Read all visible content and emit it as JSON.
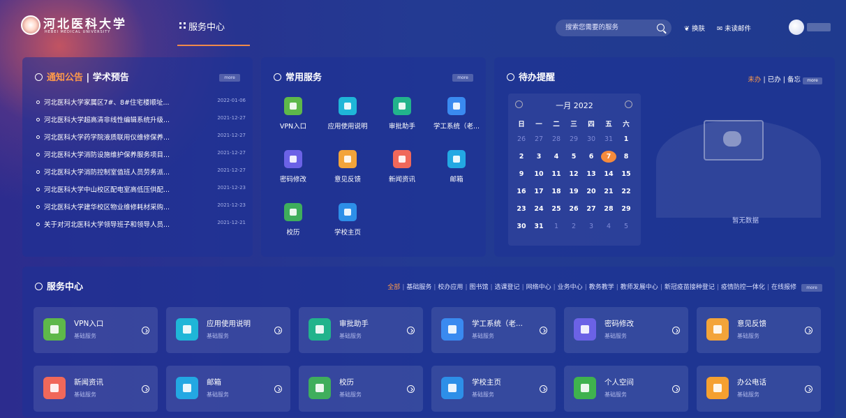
{
  "header": {
    "logo_cn": "河北医科大学",
    "logo_en": "HEBEI MEDICAL UNIVERSITY",
    "nav_tab": "服务中心",
    "search_placeholder": "搜索您需要的服务",
    "skin": "换肤",
    "mail": "未读邮件"
  },
  "notice": {
    "title_a": "通知公告",
    "sep": " | ",
    "title_b": "学术预告",
    "more": "more",
    "items": [
      {
        "title": "河北医科大学家属区7#、8#住宅楼顺址...",
        "date": "2022-01-06"
      },
      {
        "title": "河北医科大学超高清非线性编辑系统升级...",
        "date": "2021-12-27"
      },
      {
        "title": "河北医科大学药学院液质联用仪维修保养...",
        "date": "2021-12-27"
      },
      {
        "title": "河北医科大学消防设施维护保养服务项目...",
        "date": "2021-12-27"
      },
      {
        "title": "河北医科大学消防控制室值班人员劳务派...",
        "date": "2021-12-27"
      },
      {
        "title": "河北医科大学中山校区配电室高低压供配...",
        "date": "2021-12-23"
      },
      {
        "title": "河北医科大学建华校区物业维修耗材采购...",
        "date": "2021-12-23"
      },
      {
        "title": "关于对河北医科大学领导班子和领导人员...",
        "date": "2021-12-21"
      }
    ]
  },
  "common": {
    "title": "常用服务",
    "more": "more",
    "items": [
      {
        "label": "VPN入口",
        "color": "#5eb84a"
      },
      {
        "label": "应用使用说明",
        "color": "#1fb6d8"
      },
      {
        "label": "审批助手",
        "color": "#22b38c"
      },
      {
        "label": "学工系统（老...",
        "color": "#3a8af0"
      },
      {
        "label": "密码修改",
        "color": "#6b62e6"
      },
      {
        "label": "意见反馈",
        "color": "#f3a43a"
      },
      {
        "label": "新闻资讯",
        "color": "#f0685a"
      },
      {
        "label": "邮箱",
        "color": "#23a8e3"
      },
      {
        "label": "校历",
        "color": "#3fae5c"
      },
      {
        "label": "学校主页",
        "color": "#2d8fe8"
      }
    ]
  },
  "todo": {
    "title": "待办提醒",
    "filters": {
      "a": "未办",
      "b": "已办",
      "c": "备忘",
      "more": "more"
    },
    "calendar": {
      "title": "一月 2022",
      "weekdays": [
        "日",
        "一",
        "二",
        "三",
        "四",
        "五",
        "六"
      ],
      "days": [
        "26",
        "27",
        "28",
        "29",
        "30",
        "31",
        "1",
        "2",
        "3",
        "4",
        "5",
        "6",
        "7",
        "8",
        "9",
        "10",
        "11",
        "12",
        "13",
        "14",
        "15",
        "16",
        "17",
        "18",
        "19",
        "20",
        "21",
        "22",
        "23",
        "24",
        "25",
        "26",
        "27",
        "28",
        "29",
        "30",
        "31",
        "1",
        "2",
        "3",
        "4",
        "5"
      ],
      "dim_before": 6,
      "today": "7"
    },
    "empty": "暂无数据"
  },
  "center": {
    "title": "服务中心",
    "categories": [
      "全部",
      "基础服务",
      "校办应用",
      "图书馆",
      "选课登记",
      "网络中心",
      "业务中心",
      "教务教学",
      "教师发展中心",
      "新冠疫苗接种登记",
      "疫情防控一体化",
      "在线报修"
    ],
    "more": "more",
    "cards": [
      {
        "name": "VPN入口",
        "sub": "基础服务",
        "color": "#5eb84a"
      },
      {
        "name": "应用使用说明",
        "sub": "基础服务",
        "color": "#1fb6d8"
      },
      {
        "name": "审批助手",
        "sub": "基础服务",
        "color": "#22b38c"
      },
      {
        "name": "学工系统（老...",
        "sub": "基础服务",
        "color": "#3a8af0"
      },
      {
        "name": "密码修改",
        "sub": "基础服务",
        "color": "#6b62e6"
      },
      {
        "name": "意见反馈",
        "sub": "基础服务",
        "color": "#f3a43a"
      },
      {
        "name": "新闻资讯",
        "sub": "基础服务",
        "color": "#f0685a"
      },
      {
        "name": "邮箱",
        "sub": "基础服务",
        "color": "#23a8e3"
      },
      {
        "name": "校历",
        "sub": "基础服务",
        "color": "#3fae5c"
      },
      {
        "name": "学校主页",
        "sub": "基础服务",
        "color": "#2d8fe8"
      },
      {
        "name": "个人空间",
        "sub": "基础服务",
        "color": "#3fb24e"
      },
      {
        "name": "办公电话",
        "sub": "基础服务",
        "color": "#f5a030"
      }
    ]
  }
}
